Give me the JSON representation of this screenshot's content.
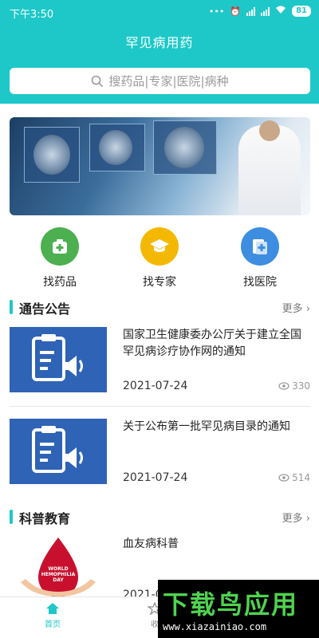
{
  "status_bar": {
    "time": "下午3:50",
    "battery": "81"
  },
  "app": {
    "title": "罕见病用药"
  },
  "search": {
    "placeholder": "搜药品|专家|医院|病种"
  },
  "quick_actions": [
    {
      "label": "找药品",
      "icon": "medicine-box-icon",
      "color": "#4caf50"
    },
    {
      "label": "找专家",
      "icon": "graduation-cap-icon",
      "color": "#f5b800"
    },
    {
      "label": "找医院",
      "icon": "hospital-icon",
      "color": "#3d8de0"
    }
  ],
  "notices": {
    "title": "通告公告",
    "more": "更多",
    "items": [
      {
        "title": "国家卫生健康委办公厅关于建立全国罕见病诊疗协作网的通知",
        "date": "2021-07-24",
        "views": "330"
      },
      {
        "title": "关于公布第一批罕见病目录的通知",
        "date": "2021-07-24",
        "views": "514"
      }
    ]
  },
  "science": {
    "title": "科普教育",
    "more": "更多",
    "items": [
      {
        "title": "血友病科普",
        "date": "2021-0",
        "badge_line1": "WORLD",
        "badge_line2": "HEMOPHILIA DAY"
      }
    ]
  },
  "bottom_nav": [
    {
      "label": "首页",
      "icon": "home-icon"
    },
    {
      "label": "收",
      "icon": "star-icon"
    }
  ],
  "watermark": {
    "big": "下载鸟应用",
    "small": "www.xiazainiao.com"
  },
  "colors": {
    "accent": "#1ec8c8",
    "thumb": "#2e63b6"
  }
}
